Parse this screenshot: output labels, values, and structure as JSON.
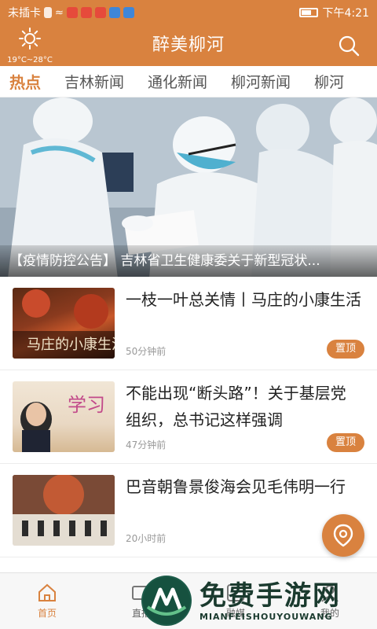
{
  "status_bar": {
    "carrier": "未插卡",
    "time": "下午4:21"
  },
  "header": {
    "title": "醉美柳河",
    "weather_temp": "19°C~28°C",
    "weather_icon": "sun-icon",
    "search_icon": "search-icon"
  },
  "tabs": [
    {
      "label": "热点",
      "active": true
    },
    {
      "label": "吉林新闻"
    },
    {
      "label": "通化新闻"
    },
    {
      "label": "柳河新闻"
    },
    {
      "label": "柳河"
    }
  ],
  "banner": {
    "caption": "【疫情防控公告】 吉林省卫生健康委关于新型冠状..."
  },
  "news": [
    {
      "title": "一枝一叶总关情丨马庄的小康生活",
      "time": "50分钟前",
      "badge": "置顶",
      "thumb_text": "马庄的小康生活"
    },
    {
      "title": "不能出现“断头路”！关于基层党组织，总书记这样强调",
      "time": "47分钟前",
      "badge": "置顶",
      "thumb_text": "学习"
    },
    {
      "title": "巴音朝鲁景俊海会见毛伟明一行",
      "time": "20小时前"
    }
  ],
  "bottom_nav": [
    {
      "label": "首页",
      "icon": "home-icon",
      "active": true
    },
    {
      "label": "直播",
      "icon": "tv-icon"
    },
    {
      "label": "融媒",
      "icon": "media-icon"
    },
    {
      "label": "我的",
      "icon": "user-icon"
    }
  ],
  "watermark": {
    "main": "免费手游网",
    "sub": "MIANFEISHOUYOUWANG"
  },
  "colors": {
    "accent": "#d9823f",
    "badge": "#d9823f"
  }
}
